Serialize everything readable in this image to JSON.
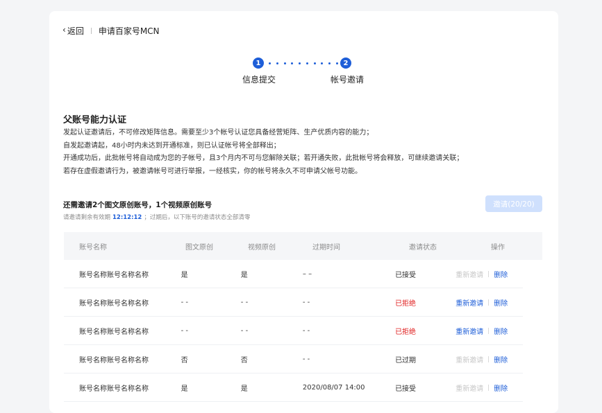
{
  "header": {
    "back_label": "返回",
    "title": "申请百家号MCN"
  },
  "steps": [
    {
      "number": "1",
      "label": "信息提交"
    },
    {
      "number": "2",
      "label": "帐号邀请"
    }
  ],
  "section": {
    "title": "父账号能力认证",
    "lines": [
      "发起认证邀请后，不可修改矩阵信息。需要至少3个帐号认证您具备经营矩阵、生产优质内容的能力；",
      "自发起邀请起，48小时内未达到开通标准，则已认证帐号将全部释出；",
      "开通成功后，此批帐号将自动成为您的子帐号，且3个月内不可与您解除关联；若开通失败，此批帐号将会释放，可继续邀请关联；",
      "若存在虚假邀请行为，被邀请帐号可进行举报，一经核实，你的帐号将永久不可申请父帐号功能。"
    ]
  },
  "invite": {
    "title": "还需邀请2个图文原创账号，1个视频原创账号",
    "sub_prefix": "请邀请剩余有效期",
    "countdown": "12:12:12",
    "sub_suffix": "；过期后，以下账号的邀请状态全部清零",
    "button_label": "邀请(20/20)"
  },
  "table": {
    "headers": [
      "账号名称",
      "图文原创",
      "视频原创",
      "过期时间",
      "邀请状态",
      "操作"
    ],
    "rows": [
      {
        "name": "账号名称账号名称名称",
        "text_orig": "是",
        "video_orig": "是",
        "expire": "– –",
        "status": "已接受",
        "reinvite": "重新邀请",
        "delete": "删除"
      },
      {
        "name": "账号名称账号名称名称",
        "text_orig": "- -",
        "video_orig": "- -",
        "expire": "- -",
        "status": "已拒绝",
        "reinvite": "重新邀请",
        "delete": "删除"
      },
      {
        "name": "账号名称账号名称名称",
        "text_orig": "- -",
        "video_orig": "- -",
        "expire": "- -",
        "status": "已拒绝",
        "reinvite": "重新邀请",
        "delete": "删除"
      },
      {
        "name": "账号名称账号名称名称",
        "text_orig": "否",
        "video_orig": "否",
        "expire": "- -",
        "status": "已过期",
        "reinvite": "重新邀请",
        "delete": "删除"
      },
      {
        "name": "账号名称账号名称名称",
        "text_orig": "是",
        "video_orig": "是",
        "expire": "2020/08/07 14:00",
        "status": "已接受",
        "reinvite": "重新邀请",
        "delete": "删除"
      }
    ]
  },
  "colors": {
    "accent": "#1e5ed8",
    "danger": "#e02020",
    "disabled": "#c7c7c7",
    "button_disabled_bg": "#cfe0fd"
  }
}
